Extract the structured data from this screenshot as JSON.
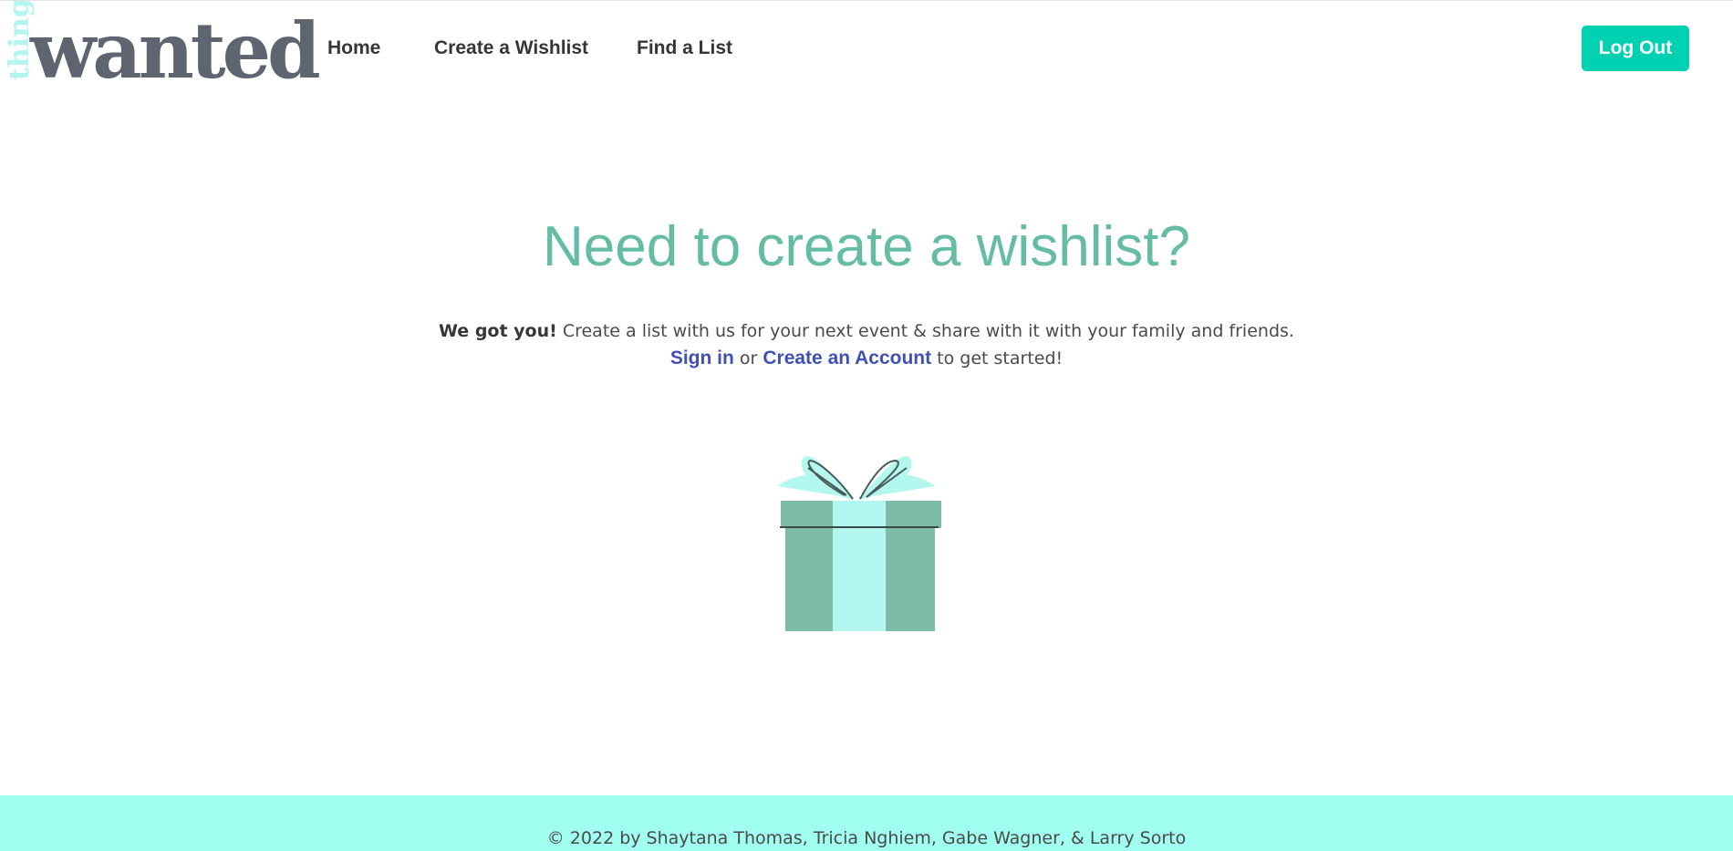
{
  "logo": {
    "side_text": "things",
    "main_text": "wanted"
  },
  "nav": {
    "home": "Home",
    "create_wishlist": "Create a Wishlist",
    "find_list": "Find a List",
    "logout": "Log Out"
  },
  "hero": {
    "title": "Need to create a wishlist?",
    "lead_bold": "We got you!",
    "lead_text": " Create a list with us for your next event & share with it with your family and friends.",
    "signin_link": "Sign in",
    "or_text": " or ",
    "create_account_link": "Create an Account",
    "started_text": " to get started!"
  },
  "illustration": {
    "icon": "gift-icon"
  },
  "footer": {
    "text": "© 2022 by Shaytana Thomas, Tricia Nghiem, Gabe Wagner, & Larry Sorto"
  },
  "colors": {
    "accent": "#00d1b2",
    "title": "#65bca5",
    "link": "#3f51b5",
    "footer_bg": "#a0fff0",
    "logo": "#5e6470",
    "logo_side": "#b2f5f1",
    "gift_box": "#7dbca8",
    "gift_ribbon": "#b2f8f0"
  }
}
